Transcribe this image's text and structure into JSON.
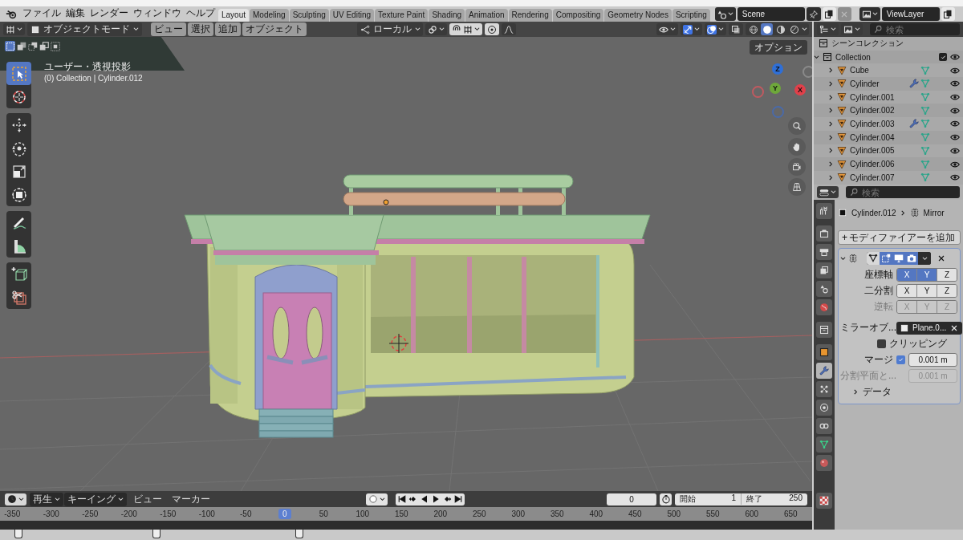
{
  "app_menu": [
    "ファイル",
    "編集",
    "レンダー",
    "ウィンドウ",
    "ヘルプ"
  ],
  "workspace_tabs": [
    {
      "label": "Layout",
      "selected": true
    },
    {
      "label": "Modeling",
      "selected": false
    },
    {
      "label": "Sculpting",
      "selected": false
    },
    {
      "label": "UV Editing",
      "selected": false
    },
    {
      "label": "Texture Paint",
      "selected": false
    },
    {
      "label": "Shading",
      "selected": false
    },
    {
      "label": "Animation",
      "selected": false
    },
    {
      "label": "Rendering",
      "selected": false
    },
    {
      "label": "Compositing",
      "selected": false
    },
    {
      "label": "Geometry Nodes",
      "selected": false
    },
    {
      "label": "Scripting",
      "selected": false
    }
  ],
  "scene": {
    "name": "Scene"
  },
  "view_layer": {
    "name": "ViewLayer"
  },
  "viewport": {
    "mode": "オブジェクトモード",
    "menus": [
      "ビュー",
      "選択",
      "追加",
      "オブジェクト"
    ],
    "orientation": "ローカル",
    "snap": {
      "on": true
    },
    "proportional_editing": {
      "on": true
    },
    "header_toggles": [
      {
        "kind": "visibility",
        "on": false
      },
      {
        "kind": "gizmos",
        "on": true
      },
      {
        "kind": "overlays",
        "on": true
      },
      {
        "kind": "xray",
        "on": false
      }
    ],
    "shading_modes": [
      {
        "kind": "wireframe",
        "selected": false
      },
      {
        "kind": "solid",
        "selected": true
      },
      {
        "kind": "material",
        "selected": false
      },
      {
        "kind": "rendered",
        "selected": false
      }
    ],
    "select_modes": [
      {
        "kind": "new",
        "selected": true
      },
      {
        "kind": "extend",
        "selected": false
      },
      {
        "kind": "subtract",
        "selected": false
      },
      {
        "kind": "invert",
        "selected": false
      },
      {
        "kind": "intersect",
        "selected": false
      }
    ],
    "options_button": "オプション",
    "view_name": "ユーザー・透視投影",
    "context_info": "(0) Collection | Cylinder.012",
    "tool_groups": [
      [
        {
          "kind": "select_box",
          "selected": true
        },
        {
          "kind": "cursor",
          "selected": false
        }
      ],
      [
        {
          "kind": "move",
          "selected": false
        },
        {
          "kind": "rotate",
          "selected": false
        },
        {
          "kind": "scale",
          "selected": false
        },
        {
          "kind": "transform",
          "selected": false
        }
      ],
      [
        {
          "kind": "annotate",
          "selected": false
        },
        {
          "kind": "measure",
          "selected": false
        }
      ],
      [
        {
          "kind": "add_cube",
          "selected": false
        },
        {
          "kind": "cut",
          "selected": false
        }
      ]
    ],
    "gizmo_axes": [
      {
        "label": "Z",
        "color": "#2f6fd6"
      },
      {
        "label": "Y",
        "color": "#6ea83a"
      },
      {
        "label": "X",
        "color": "#e0404a"
      }
    ]
  },
  "outliner": {
    "search_placeholder": "検索",
    "root": "シーンコレクション",
    "collection": {
      "name": "Collection",
      "checked": true,
      "expanded": true,
      "visible": true,
      "children": [
        {
          "name": "Cube",
          "has_modifier": false,
          "expanded": false,
          "visible": true
        },
        {
          "name": "Cylinder",
          "has_modifier": true,
          "expanded": false,
          "visible": true
        },
        {
          "name": "Cylinder.001",
          "has_modifier": false,
          "expanded": false,
          "visible": true
        },
        {
          "name": "Cylinder.002",
          "has_modifier": false,
          "expanded": false,
          "visible": true
        },
        {
          "name": "Cylinder.003",
          "has_modifier": true,
          "expanded": false,
          "visible": true
        },
        {
          "name": "Cylinder.004",
          "has_modifier": false,
          "expanded": false,
          "visible": true
        },
        {
          "name": "Cylinder.005",
          "has_modifier": false,
          "expanded": false,
          "visible": true
        },
        {
          "name": "Cylinder.006",
          "has_modifier": false,
          "expanded": false,
          "visible": true
        },
        {
          "name": "Cylinder.007",
          "has_modifier": false,
          "expanded": false,
          "visible": true
        }
      ]
    }
  },
  "properties": {
    "search_placeholder": "検索",
    "tab_groups": [
      [
        {
          "kind": "tool",
          "selected": false
        }
      ],
      [
        {
          "kind": "render",
          "selected": false
        },
        {
          "kind": "output",
          "selected": false
        },
        {
          "kind": "view_layer",
          "selected": false
        },
        {
          "kind": "scene",
          "selected": false
        },
        {
          "kind": "world",
          "selected": false
        }
      ],
      [
        {
          "kind": "collection",
          "selected": false
        }
      ],
      [
        {
          "kind": "object",
          "selected": false
        },
        {
          "kind": "modifiers",
          "selected": true
        },
        {
          "kind": "particles",
          "selected": false
        },
        {
          "kind": "physics",
          "selected": false
        },
        {
          "kind": "constraints",
          "selected": false
        },
        {
          "kind": "data",
          "selected": false
        },
        {
          "kind": "material",
          "selected": false
        }
      ],
      [
        {
          "kind": "texture",
          "selected": false
        }
      ]
    ],
    "object_name": "Cylinder.012",
    "modifier_name": "Mirror",
    "add_button": {
      "icon": "+",
      "label": "モディファイアーを追加"
    },
    "modifier": {
      "expanded": true,
      "toggles": [
        {
          "kind": "on_cage",
          "on": false
        },
        {
          "kind": "edit_mode",
          "on": true
        },
        {
          "kind": "viewport",
          "on": true
        },
        {
          "kind": "render",
          "on": true
        }
      ],
      "axis_rows": [
        {
          "label": "座標軸",
          "disabled": false,
          "buttons": [
            {
              "label": "X",
              "selected": true
            },
            {
              "label": "Y",
              "selected": true
            },
            {
              "label": "Z",
              "selected": false
            }
          ]
        },
        {
          "label": "二分割",
          "disabled": false,
          "buttons": [
            {
              "label": "X",
              "selected": false
            },
            {
              "label": "Y",
              "selected": false
            },
            {
              "label": "Z",
              "selected": false
            }
          ]
        },
        {
          "label": "逆転",
          "disabled": true,
          "buttons": [
            {
              "label": "X",
              "selected": false
            },
            {
              "label": "Y",
              "selected": false
            },
            {
              "label": "Z",
              "selected": false
            }
          ]
        }
      ],
      "mirror_object": {
        "label": "ミラーオブ...",
        "value": "Plane.0..."
      },
      "clipping": {
        "label": "クリッピング",
        "checked": false
      },
      "merge": {
        "label": "マージ",
        "checked": true,
        "value": "0.001 m"
      },
      "bisect_distance": {
        "label": "分割平面と...",
        "value": "0.001 m",
        "disabled": true
      },
      "subpanels": [
        {
          "label": "データ",
          "expanded": false
        }
      ]
    }
  },
  "timeline": {
    "menus": [
      {
        "label": "再生",
        "kind": "dropdown"
      },
      {
        "label": "キーイング",
        "kind": "dropdown"
      },
      {
        "label": "ビュー",
        "kind": "plain"
      },
      {
        "label": "マーカー",
        "kind": "plain"
      }
    ],
    "auto_keying": false,
    "current_frame": "0",
    "start": {
      "label": "開始",
      "value": "1"
    },
    "end": {
      "label": "終了",
      "value": "250"
    },
    "ruler": [
      {
        "label": "-350",
        "current": false
      },
      {
        "label": "-300",
        "current": false
      },
      {
        "label": "-250",
        "current": false
      },
      {
        "label": "-200",
        "current": false
      },
      {
        "label": "-150",
        "current": false
      },
      {
        "label": "-100",
        "current": false
      },
      {
        "label": "-50",
        "current": false
      },
      {
        "label": "0",
        "current": true
      },
      {
        "label": "50",
        "current": false
      },
      {
        "label": "100",
        "current": false
      },
      {
        "label": "150",
        "current": false
      },
      {
        "label": "200",
        "current": false
      },
      {
        "label": "250",
        "current": false
      },
      {
        "label": "300",
        "current": false
      },
      {
        "label": "350",
        "current": false
      },
      {
        "label": "400",
        "current": false
      },
      {
        "label": "450",
        "current": false
      },
      {
        "label": "500",
        "current": false
      },
      {
        "label": "550",
        "current": false
      },
      {
        "label": "600",
        "current": false
      },
      {
        "label": "650",
        "current": false
      }
    ]
  }
}
